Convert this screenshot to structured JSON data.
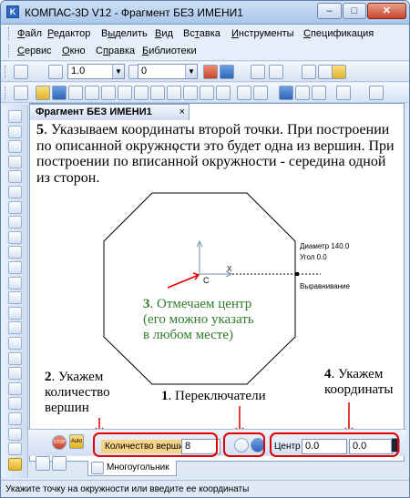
{
  "window": {
    "title": "КОМПАС-3D V12 - Фрагмент БЕЗ ИМЕНИ1",
    "min": "–",
    "max": "□",
    "close": "✕"
  },
  "menu": {
    "row1": [
      {
        "label": "Файл",
        "u": "Ф"
      },
      {
        "label": "Редактор",
        "u": "Р"
      },
      {
        "label": "Выделить",
        "u": "ы"
      },
      {
        "label": "Вид",
        "u": "В"
      },
      {
        "label": "Вставка",
        "u": "т"
      },
      {
        "label": "Инструменты",
        "u": "И"
      },
      {
        "label": "Спецификация",
        "u": "С"
      }
    ],
    "row2": [
      {
        "label": "Сервис",
        "u": "С"
      },
      {
        "label": "Окно",
        "u": "О"
      },
      {
        "label": "Справка",
        "u": "п"
      },
      {
        "label": "Библиотеки",
        "u": "Б"
      }
    ]
  },
  "toolbar": {
    "scale": "1.0",
    "layer": "0"
  },
  "document": {
    "tab_label": "Фрагмент БЕЗ ИМЕНИ1",
    "tab_close": "×"
  },
  "annotation": {
    "step5_num": "5",
    "step5_text": ". Указываем координаты второй точки. При построении по описанной окружности это будет одна из вершин. При построении по вписанной окружности - середина одной из сторон.",
    "step3_num": "3",
    "step3_text": ". Отмечаем центр (его можно указать в любом месте)",
    "step2_num": "2",
    "step2_text": ". Укажем количество вершин",
    "step1_num": "1",
    "step1_text": ". Переключатели",
    "step4_num": "4",
    "step4_text": ". Укажем координаты"
  },
  "canvas": {
    "diameter_label": "Диаметр 140.0",
    "angle_label": "Угол    0.0",
    "align_label": "Выравнивание",
    "axis_x": "X",
    "axis_y": "Y",
    "point_marker": "C"
  },
  "properties": {
    "vertex_label": "Количество вершин",
    "vertex_value": "8",
    "center_label": "Центр",
    "center_x": "0.0",
    "center_y": "0.0",
    "stop": "STOP",
    "auto": "Auto"
  },
  "bottom_tab": {
    "label": "Многоугольник"
  },
  "status": {
    "text": "Укажите точку на окружности или введите ее координаты"
  }
}
